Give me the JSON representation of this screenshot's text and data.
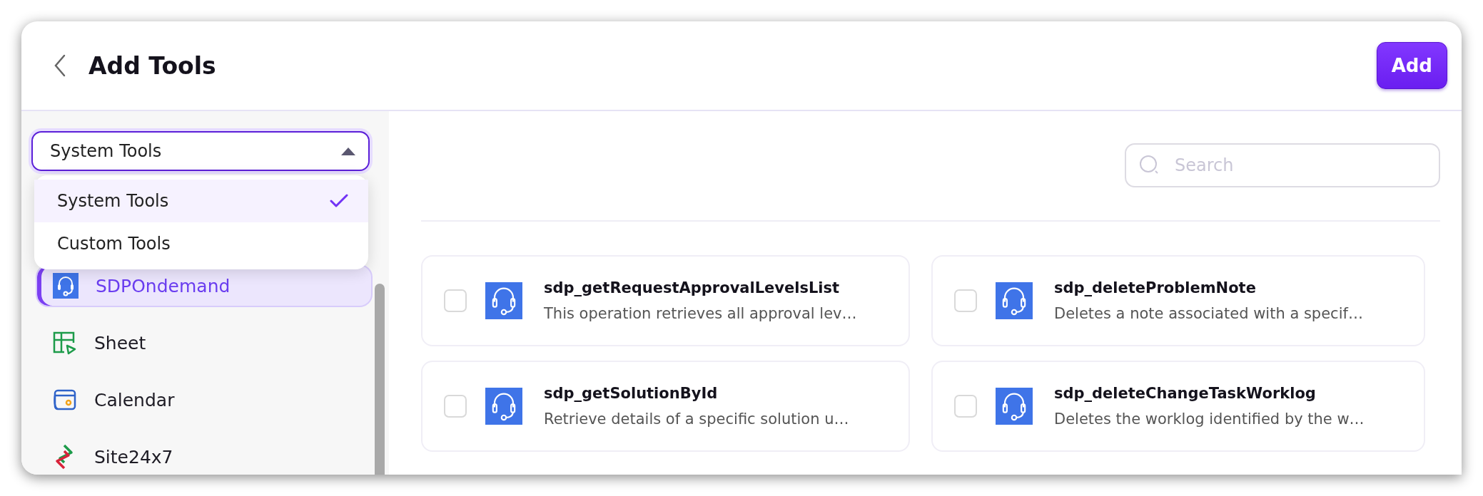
{
  "header": {
    "title": "Add Tools",
    "add_button": "Add"
  },
  "source_select": {
    "value": "System Tools",
    "expanded": true,
    "options": [
      {
        "label": "System Tools",
        "selected": true
      },
      {
        "label": "Custom Tools",
        "selected": false
      }
    ]
  },
  "apps": [
    {
      "name": "SDPOndemand",
      "kind": "sdp",
      "selected": true
    },
    {
      "name": "Sheet",
      "kind": "sheet",
      "selected": false
    },
    {
      "name": "Calendar",
      "kind": "calendar",
      "selected": false
    },
    {
      "name": "Site24x7",
      "kind": "site",
      "selected": false
    }
  ],
  "search": {
    "placeholder": "Search"
  },
  "tools": [
    {
      "name": "sdp_getRequestApprovalLevelsList",
      "description": "This operation retrieves all approval lev…",
      "checked": false
    },
    {
      "name": "sdp_deleteProblemNote",
      "description": "Deletes a note associated with a specif…",
      "checked": false
    },
    {
      "name": "sdp_getSolutionById",
      "description": "Retrieve details of a specific solution u…",
      "checked": false
    },
    {
      "name": "sdp_deleteChangeTaskWorklog",
      "description": "Deletes the worklog identified by the w…",
      "checked": false
    }
  ]
}
